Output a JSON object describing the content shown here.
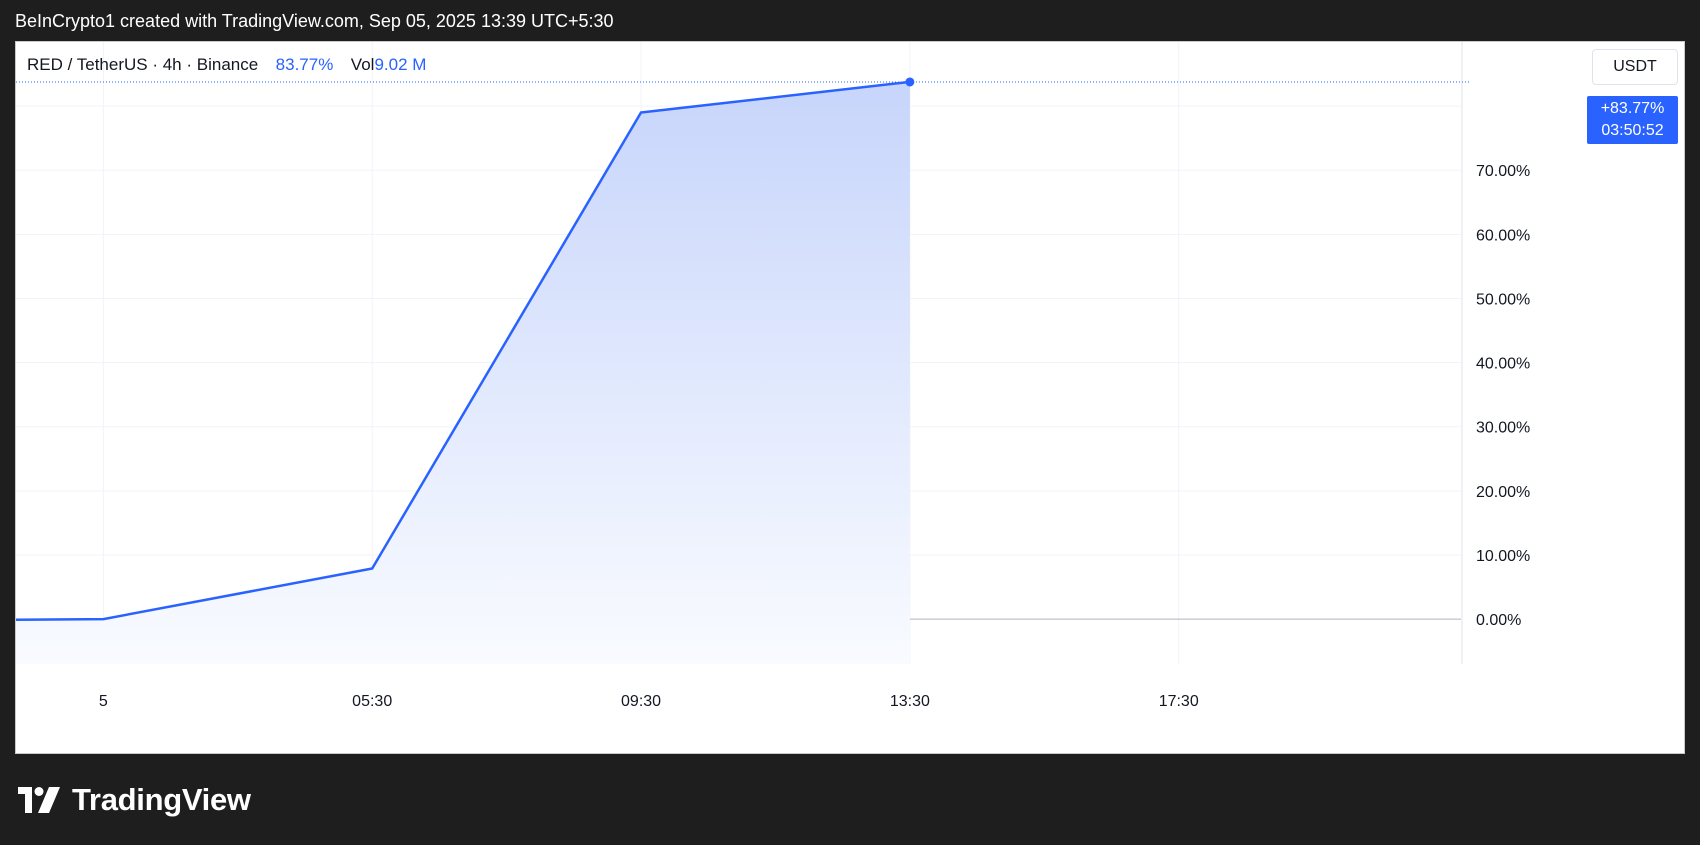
{
  "header": {
    "caption": "BeInCrypto1 created with TradingView.com, Sep 05, 2025 13:39 UTC+5:30"
  },
  "legend": {
    "symbol": "RED / TetherUS · 4h · Binance",
    "change": "83.77%",
    "volume_label": "Vol",
    "volume_value": "9.02 M"
  },
  "currency_button": {
    "label": "USDT"
  },
  "price_tag": {
    "change": "+83.77%",
    "countdown": "03:50:52"
  },
  "footer": {
    "brand": "TradingView"
  },
  "colors": {
    "line": "#2962ff",
    "area_top": "#c7d5fb",
    "area_bottom": "#f9fbff",
    "grid": "#f0f3fa",
    "baseline": "#b2b5be",
    "axis_text": "#131722",
    "background": "#1e1e1e"
  },
  "chart_data": {
    "type": "area",
    "scale": "percent",
    "x_ticks": [
      "5",
      "05:30",
      "09:30",
      "13:30",
      "17:30"
    ],
    "x_tick_hours": [
      1.5,
      5.5,
      9.5,
      13.5,
      17.5
    ],
    "x_range_hours": [
      0.2,
      21.7
    ],
    "x": [
      0.2,
      1.5,
      5.5,
      9.5,
      13.5
    ],
    "values": [
      -0.1,
      0.0,
      7.9,
      79.0,
      83.77
    ],
    "last_value": 83.77,
    "y_ticks": [
      0,
      10,
      20,
      30,
      40,
      50,
      60,
      70
    ],
    "y_tick_labels": [
      "0.00%",
      "10.00%",
      "20.00%",
      "30.00%",
      "40.00%",
      "50.00%",
      "60.00%",
      "70.00%"
    ],
    "ylim": [
      -7,
      90
    ],
    "grid": true,
    "baseline": 0
  }
}
